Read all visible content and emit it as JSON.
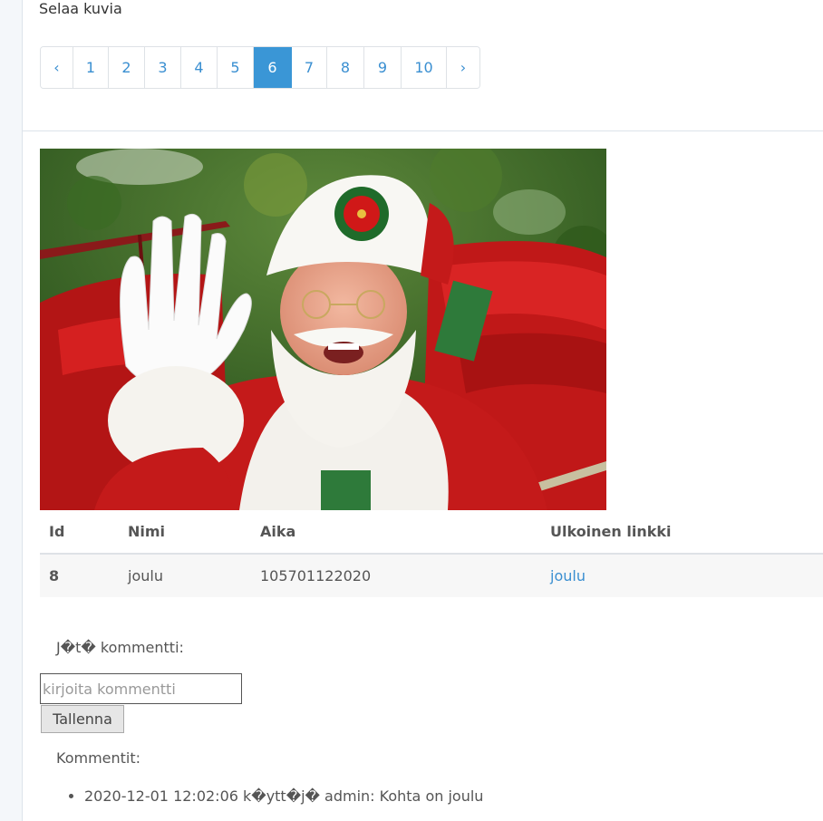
{
  "page": {
    "heading": "Selaa kuvia"
  },
  "pagination": {
    "prev": "‹",
    "next": "›",
    "pages": [
      "1",
      "2",
      "3",
      "4",
      "5",
      "6",
      "7",
      "8",
      "9",
      "10"
    ],
    "active": "6"
  },
  "image": {
    "subject": "santa-claus-photo"
  },
  "table": {
    "headers": [
      "Id",
      "Nimi",
      "Aika",
      "Ulkoinen linkki"
    ],
    "row": {
      "id": "8",
      "name": "joulu",
      "time": "105701122020",
      "link": "joulu"
    }
  },
  "comment_form": {
    "prompt": "J�t� kommentti:",
    "placeholder": "kirjoita kommentti",
    "submit": "Tallenna"
  },
  "comments": {
    "label": "Kommentit:",
    "items": [
      "2020-12-01 12:02:06 k�ytt�j� admin: Kohta on joulu"
    ]
  },
  "colors": {
    "accent": "#3a96d6",
    "link": "#3a8fd1"
  }
}
